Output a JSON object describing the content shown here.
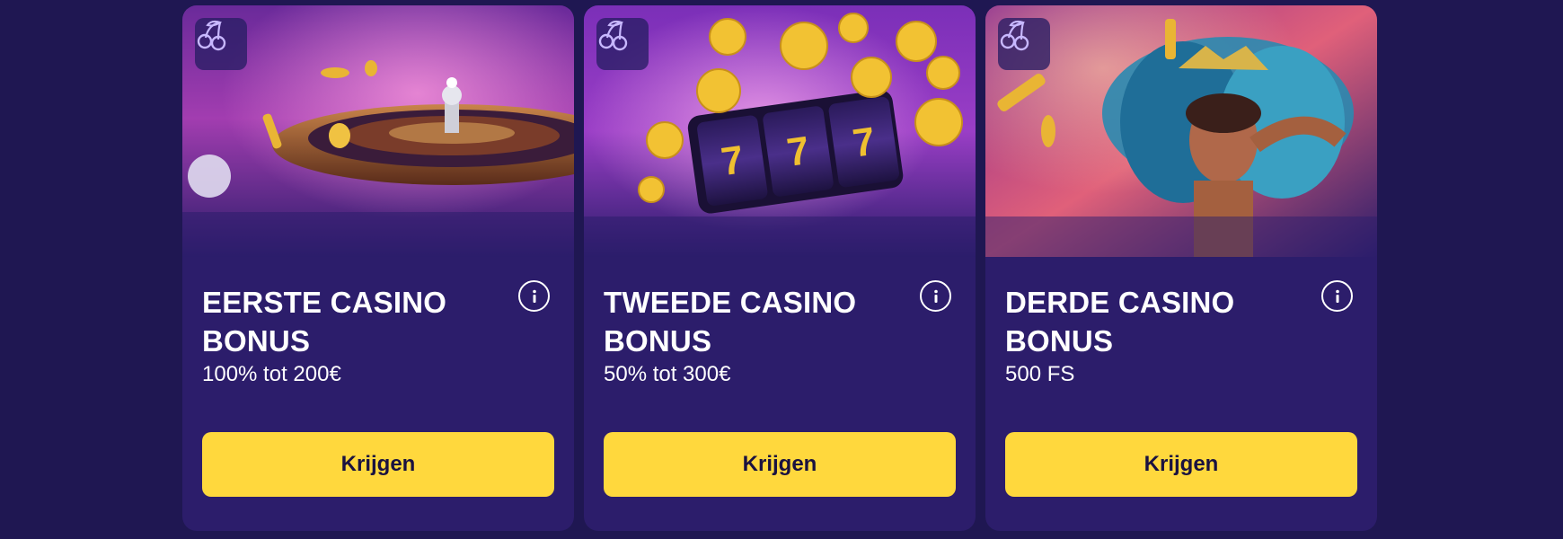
{
  "colors": {
    "page_bg": "#1f1752",
    "card_bg": "#2c1d6b",
    "button_bg": "#ffd83d",
    "button_text": "#1a1240",
    "text": "#ffffff"
  },
  "cards": [
    {
      "image": "roulette-wheel-image",
      "badge_icon": "cherries-icon",
      "title": "EERSTE CASINO BONUS",
      "subtitle": "100% tot 200€",
      "button_label": "Krijgen",
      "info_icon": "info-icon"
    },
    {
      "image": "slot-machine-777-image",
      "badge_icon": "cherries-icon",
      "title": "TWEEDE CASINO BONUS",
      "subtitle": "50% tot 300€",
      "button_label": "Krijgen",
      "info_icon": "info-icon"
    },
    {
      "image": "carnival-dancer-image",
      "badge_icon": "cherries-icon",
      "title": "DERDE CASINO BONUS",
      "subtitle": "500 FS",
      "button_label": "Krijgen",
      "info_icon": "info-icon"
    }
  ]
}
